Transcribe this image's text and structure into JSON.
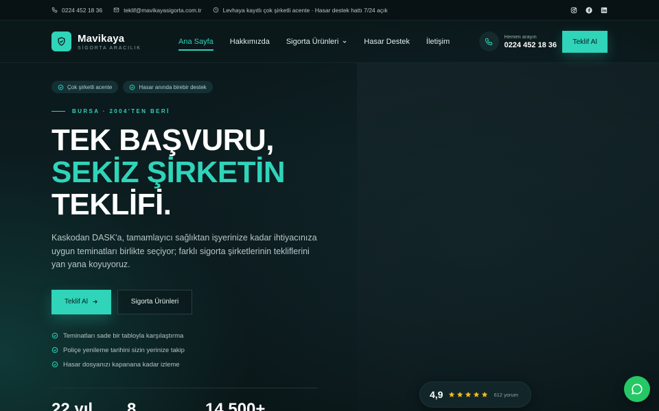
{
  "topbar": {
    "phone": "0224 452 18 36",
    "email": "teklif@mavikayasigorta.com.tr",
    "info": "Levhaya kayıtlı çok şirketli acente · Hasar destek hattı 7/24 açık",
    "social": [
      "instagram-icon",
      "facebook-icon",
      "linkedin-icon"
    ]
  },
  "header": {
    "brand": "Mavikaya",
    "brand_sub": "SİGORTA ARACILIK",
    "nav": [
      {
        "label": "Ana Sayfa",
        "active": true
      },
      {
        "label": "Hakkımızda"
      },
      {
        "label": "Sigorta Ürünleri",
        "dropdown": true
      },
      {
        "label": "Hasar Destek"
      },
      {
        "label": "İletişim"
      }
    ],
    "call_label": "Hemen arayın",
    "call_number": "0224 452 18 36",
    "cta": "Teklif Al"
  },
  "hero": {
    "badges": [
      "Çok şirketli acente",
      "Hasar anında birebir destek"
    ],
    "eyebrow": "BURSA · 2004'TEN BERİ",
    "title_line1": "TEK BAŞVURU,",
    "title_line2": "SEKİZ ŞİRKETİN",
    "title_line3": "TEKLİFİ.",
    "lead": "Kaskodan DASK'a, tamamlayıcı sağlıktan işyerinize kadar ihtiyacınıza uygun teminatları birlikte seçiyor; farklı sigorta şirketlerinin tekliflerini yan yana koyuyoruz.",
    "cta_primary": "Teklif Al",
    "cta_secondary": "Sigorta Ürünleri",
    "checks": [
      "Teminatları sade bir tabloyla karşılaştırma",
      "Poliçe yenileme tarihini sizin yerinize takip",
      "Hasar dosyanızı kapanana kadar izleme"
    ],
    "stat1": "22 yıl",
    "stat2": "8",
    "stat3": "14.500+"
  },
  "rating": {
    "score": "4,9",
    "stars": 5,
    "count": "612 yorum"
  },
  "colors": {
    "accent": "#2fd4b9",
    "background": "#0b1a1d",
    "whatsapp": "#25c865",
    "star": "#f5b81c"
  }
}
